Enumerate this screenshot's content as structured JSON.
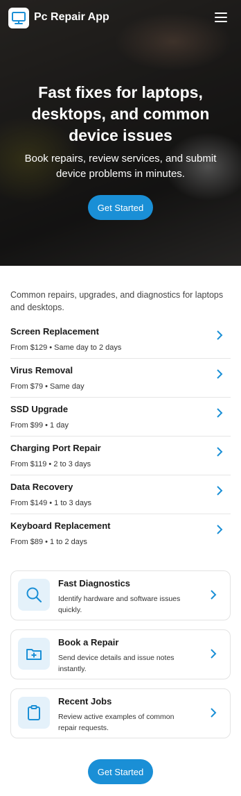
{
  "header": {
    "app_name": "Pc Repair App",
    "logo_icon": "monitor-icon",
    "menu_icon": "hamburger-menu-icon"
  },
  "hero": {
    "title": "Fast fixes for laptops, desktops, and common device issues",
    "subtitle": "Book repairs, review services, and submit device problems in minutes.",
    "cta_label": "Get Started"
  },
  "services": {
    "intro": "Common repairs, upgrades, and diagnostics for laptops and desktops.",
    "items": [
      {
        "name": "Screen Replacement",
        "meta": "From $129 • Same day to 2 days"
      },
      {
        "name": "Virus Removal",
        "meta": "From $79 • Same day"
      },
      {
        "name": "SSD Upgrade",
        "meta": "From $99 • 1 day"
      },
      {
        "name": "Charging Port Repair",
        "meta": "From $119 • 2 to 3 days"
      },
      {
        "name": "Data Recovery",
        "meta": "From $149 • 1 to 3 days"
      },
      {
        "name": "Keyboard Replacement",
        "meta": "From $89 • 1 to 2 days"
      }
    ]
  },
  "features": [
    {
      "title": "Fast Diagnostics",
      "desc": "Identify hardware and software issues quickly.",
      "icon": "search-icon"
    },
    {
      "title": "Book a Repair",
      "desc": "Send device details and issue notes instantly.",
      "icon": "folder-plus-icon"
    },
    {
      "title": "Recent Jobs",
      "desc": "Review active examples of common repair requests.",
      "icon": "clipboard-icon"
    }
  ],
  "footer": {
    "cta_label": "Get Started"
  },
  "colors": {
    "accent": "#1a8fd6",
    "icon_bg": "#e4f1fa",
    "divider": "#e6e6e6"
  }
}
